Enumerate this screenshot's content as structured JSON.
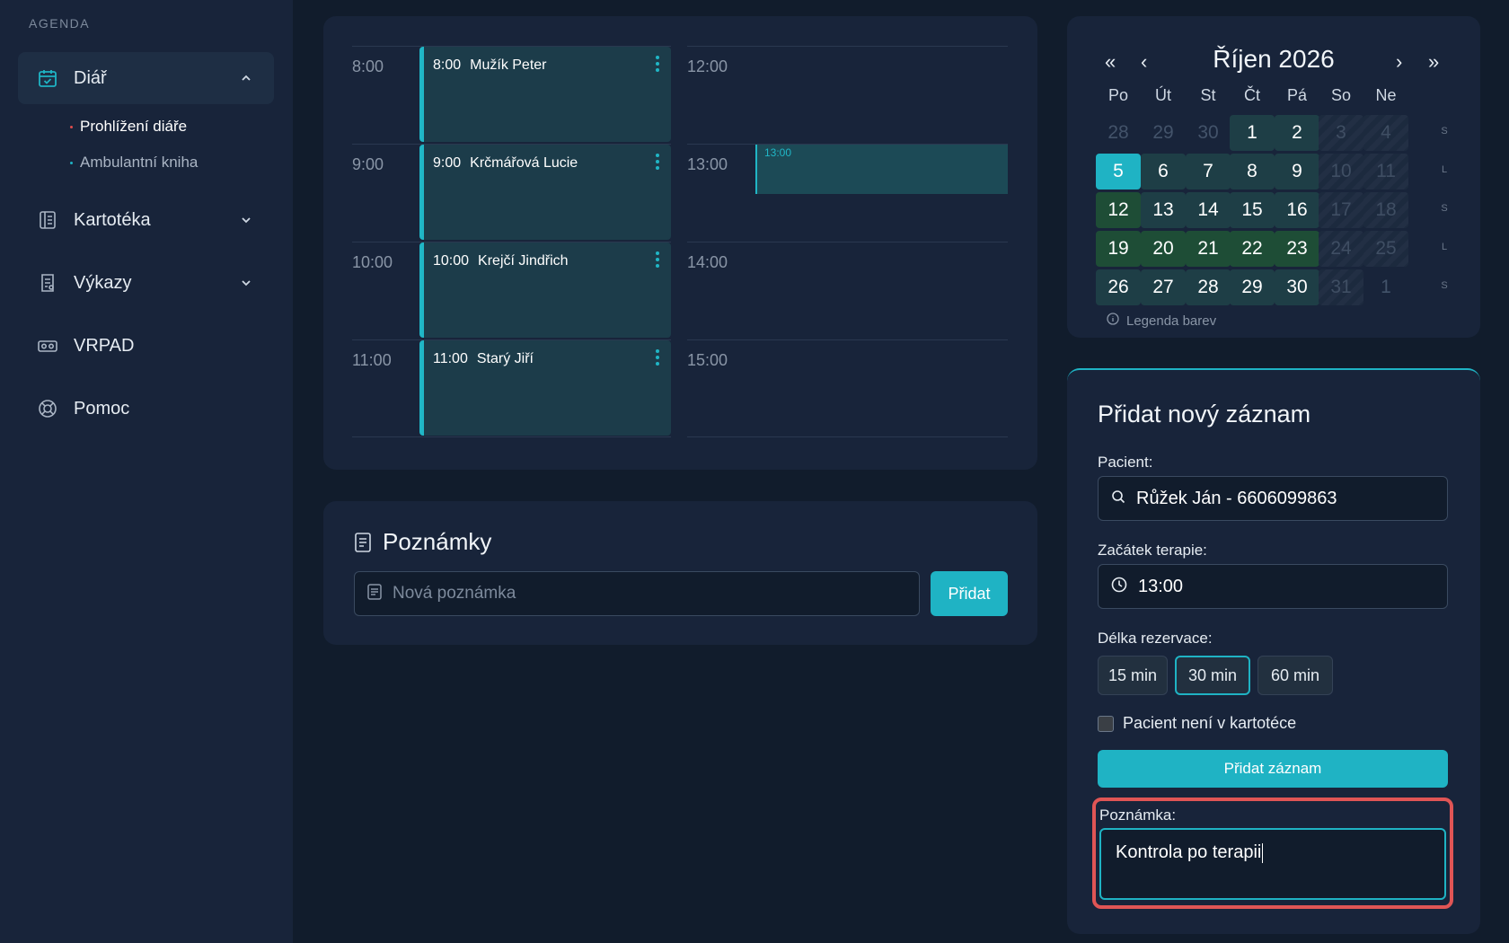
{
  "sidebar": {
    "section_label": "AGENDA",
    "items": [
      {
        "label": "Diář",
        "icon": "calendar-check-icon"
      },
      {
        "label": "Kartotéka",
        "icon": "card-index-icon"
      },
      {
        "label": "Výkazy",
        "icon": "report-icon"
      },
      {
        "label": "VRPAD",
        "icon": "vr-headset-icon"
      },
      {
        "label": "Pomoc",
        "icon": "lifebuoy-icon"
      }
    ],
    "sub_items": [
      "Prohlížení diáře",
      "Ambulantní kniha"
    ]
  },
  "schedule": {
    "hours_left": [
      "8:00",
      "9:00",
      "10:00",
      "11:00"
    ],
    "hours_right": [
      "12:00",
      "13:00",
      "14:00",
      "15:00"
    ],
    "appointments": [
      {
        "time": "8:00",
        "name": "Mužík Peter"
      },
      {
        "time": "9:00",
        "name": "Krčmářová Lucie"
      },
      {
        "time": "10:00",
        "name": "Krejčí Jindřich"
      },
      {
        "time": "11:00",
        "name": "Starý Jiří"
      }
    ],
    "new_slot_time": "13:00"
  },
  "notes": {
    "title": "Poznámky",
    "placeholder": "Nová poznámka",
    "add_label": "Přidat"
  },
  "calendar": {
    "title": "Říjen 2026",
    "nav": {
      "prev_year": "«",
      "prev_month": "‹",
      "next_month": "›",
      "next_year": "»"
    },
    "weekdays": [
      "Po",
      "Út",
      "St",
      "Čt",
      "Pá",
      "So",
      "Ne"
    ],
    "weeks": [
      [
        {
          "d": "28",
          "s": "out"
        },
        {
          "d": "29",
          "s": "out"
        },
        {
          "d": "30",
          "s": "out"
        },
        {
          "d": "1",
          "s": "teal"
        },
        {
          "d": "2",
          "s": "teal"
        },
        {
          "d": "3",
          "s": "hatch"
        },
        {
          "d": "4",
          "s": "hatch"
        }
      ],
      [
        {
          "d": "5",
          "s": "sel"
        },
        {
          "d": "6",
          "s": "teal"
        },
        {
          "d": "7",
          "s": "teal"
        },
        {
          "d": "8",
          "s": "teal"
        },
        {
          "d": "9",
          "s": "teal"
        },
        {
          "d": "10",
          "s": "hatch"
        },
        {
          "d": "11",
          "s": "hatch"
        }
      ],
      [
        {
          "d": "12",
          "s": "green"
        },
        {
          "d": "13",
          "s": "teal"
        },
        {
          "d": "14",
          "s": "teal"
        },
        {
          "d": "15",
          "s": "teal"
        },
        {
          "d": "16",
          "s": "teal"
        },
        {
          "d": "17",
          "s": "hatch"
        },
        {
          "d": "18",
          "s": "hatch"
        }
      ],
      [
        {
          "d": "19",
          "s": "green"
        },
        {
          "d": "20",
          "s": "green"
        },
        {
          "d": "21",
          "s": "green"
        },
        {
          "d": "22",
          "s": "green"
        },
        {
          "d": "23",
          "s": "green"
        },
        {
          "d": "24",
          "s": "hatch"
        },
        {
          "d": "25",
          "s": "hatch"
        }
      ],
      [
        {
          "d": "26",
          "s": "teal"
        },
        {
          "d": "27",
          "s": "teal"
        },
        {
          "d": "28",
          "s": "teal"
        },
        {
          "d": "29",
          "s": "teal"
        },
        {
          "d": "30",
          "s": "teal"
        },
        {
          "d": "31",
          "s": "hatch"
        },
        {
          "d": "1",
          "s": "out"
        }
      ]
    ],
    "week_side_letters": [
      "S",
      "L",
      "S",
      "L",
      "S"
    ],
    "legend": "Legenda barev"
  },
  "form": {
    "title": "Přidat nový záznam",
    "patient_label": "Pacient:",
    "patient_value": "Růžek Ján - 6606099863",
    "start_label": "Začátek terapie:",
    "start_value": "13:00",
    "duration_label": "Délka rezervace:",
    "durations": [
      "15 min",
      "30 min",
      "60 min"
    ],
    "selected_duration": "30 min",
    "checkbox_label": "Pacient není v kartotéce",
    "submit_label": "Přidat záznam",
    "memo_label": "Poznámka:",
    "memo_value": "Kontrola po terapii"
  },
  "colors": {
    "accent": "#1fb3c4",
    "background": "#111c2c",
    "panel": "#18243a",
    "highlight_border": "#e05555",
    "calendar_green": "#1e4d36",
    "calendar_teal": "#1e3e46"
  }
}
